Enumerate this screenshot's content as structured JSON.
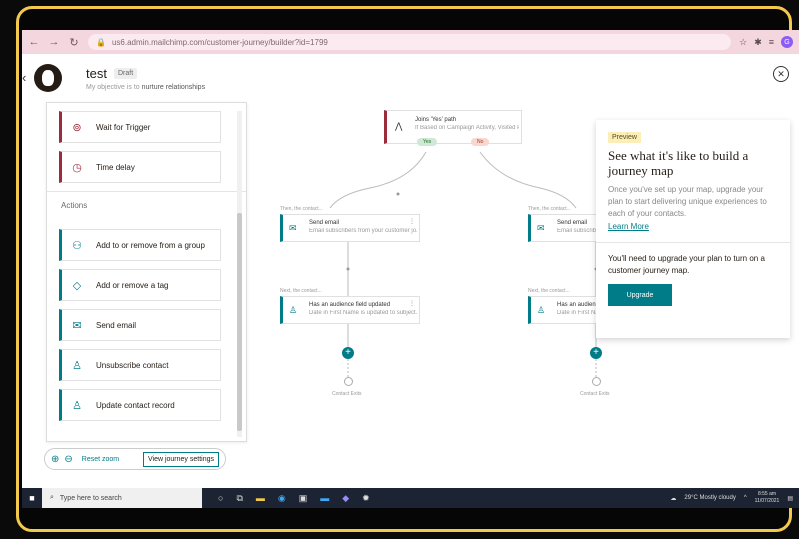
{
  "browser": {
    "url": "us6.admin.mailchimp.com/customer-journey/builder?id=1799"
  },
  "header": {
    "title": "test",
    "status": "Draft",
    "objective_prefix": "My objective is to",
    "objective_value": "nurture relationships"
  },
  "left_panel": {
    "top_items": [
      {
        "label": "Wait for Trigger",
        "icon": "trigger-icon"
      },
      {
        "label": "Time delay",
        "icon": "clock-icon"
      }
    ],
    "actions_label": "Actions",
    "actions": [
      {
        "label": "Add to or remove from a group",
        "icon": "group-icon"
      },
      {
        "label": "Add or remove a tag",
        "icon": "tag-icon"
      },
      {
        "label": "Send email",
        "icon": "email-icon"
      },
      {
        "label": "Unsubscribe contact",
        "icon": "user-icon"
      },
      {
        "label": "Update contact record",
        "icon": "user-edit-icon"
      }
    ]
  },
  "zoom_bar": {
    "reset_label": "Reset zoom",
    "settings_label": "View journey settings"
  },
  "canvas": {
    "trigger": {
      "title": "Joins 'Yes' path",
      "desc": "If Based on Campaign Activity, Visited P...",
      "yes": "Yes",
      "no": "No"
    },
    "branches": [
      {
        "caption1": "Then, the contact...",
        "email_title": "Send email",
        "email_desc": "Email subscribers from your customer jo...",
        "caption2": "Next, the contact...",
        "update_title": "Has an audience field updated",
        "update_desc": "Date in First Name is updated to subject...",
        "end_label": "Contact Exits"
      },
      {
        "caption1": "Then, the contact...",
        "email_title": "Send email",
        "email_desc": "Email subscribers from your customer jo...",
        "caption2": "Next, the contact...",
        "update_title": "Has an audience field up...",
        "update_desc": "Date in First Name is updated to...",
        "end_label": "Contact Exits"
      }
    ]
  },
  "preview": {
    "badge": "Preview",
    "title": "See what it's like to build a journey map",
    "text": "Once you've set up your map, upgrade your plan to start delivering unique experiences to each of your contacts.",
    "learn_more": "Learn More",
    "upgrade_text": "You'll need to upgrade your plan to turn on a customer journey map.",
    "upgrade_button": "Upgrade"
  },
  "taskbar": {
    "search_placeholder": "Type here to search",
    "weather": "29°C  Mostly cloudy",
    "time": "8:55 am",
    "date": "11/07/2021"
  },
  "colors": {
    "accent": "#007c89",
    "trigger": "#9b2c3b",
    "frame": "#f2c94c"
  }
}
